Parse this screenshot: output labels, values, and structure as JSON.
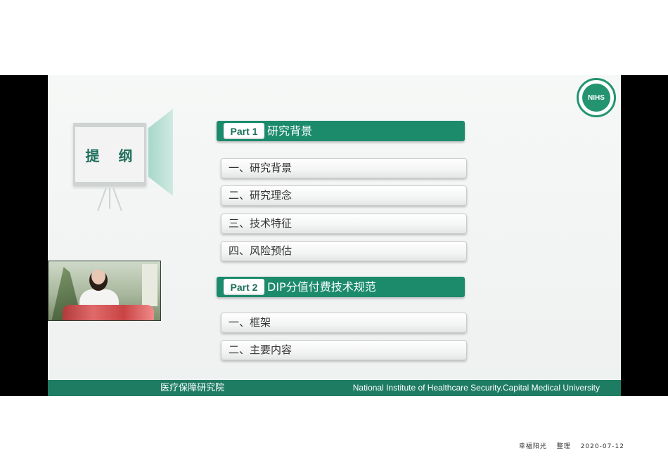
{
  "slide": {
    "outline_title": "提 纲",
    "logo_text": "NIHS",
    "parts": [
      {
        "badge": "Part 1",
        "title": "研究背景",
        "items": [
          "一、研究背景",
          "二、研究理念",
          "三、技术特征",
          "四、风险预估"
        ]
      },
      {
        "badge": "Part 2",
        "title": "DIP分值付费技术规范",
        "items": [
          "一、框架",
          "二、主要内容"
        ]
      }
    ],
    "bottom_bar": {
      "left": "医疗保障研究院",
      "right": "National Institute of Healthcare Security.Capital Medical University"
    }
  },
  "footer": {
    "author": "幸福阳光",
    "action": "整理",
    "date": "2020-07-12"
  },
  "colors": {
    "brand_green": "#1b8b6c",
    "bar_green": "#1e7c63"
  }
}
